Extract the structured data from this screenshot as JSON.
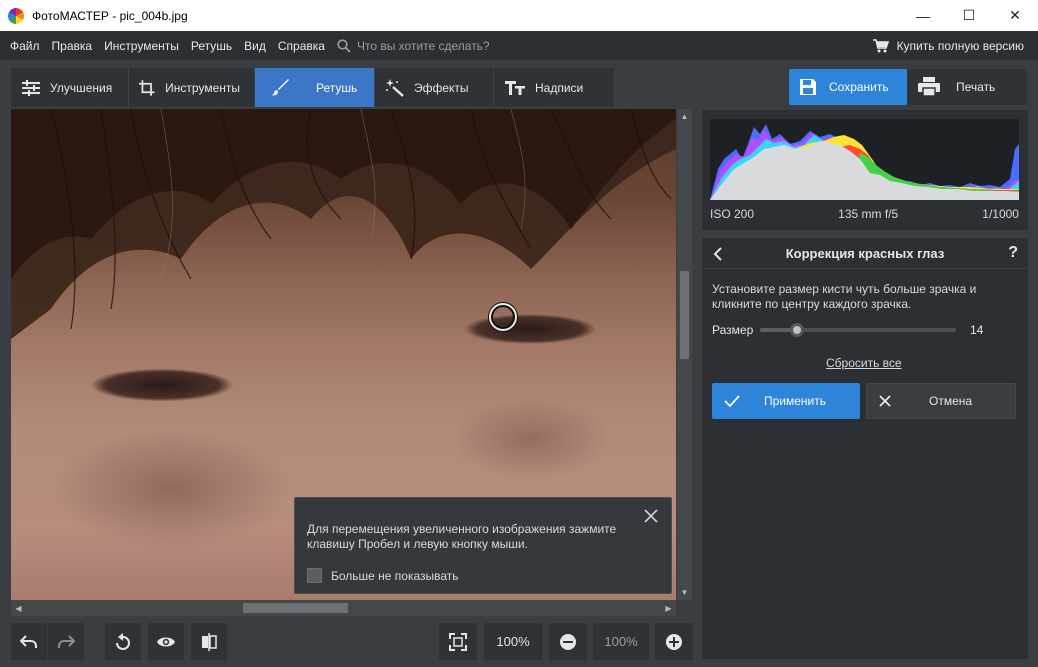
{
  "window": {
    "title": "ФотоМАСТЕР - pic_004b.jpg",
    "minimize_glyph": "—",
    "maximize_glyph": "☐",
    "close_glyph": "✕"
  },
  "menu": {
    "items": [
      "Файл",
      "Правка",
      "Инструменты",
      "Ретушь",
      "Вид",
      "Справка"
    ],
    "search_placeholder": "Что вы хотите сделать?",
    "buy_label": "Купить полную версию"
  },
  "tabs": [
    {
      "label": "Улучшения",
      "icon": "sliders-icon",
      "active": false
    },
    {
      "label": "Инструменты",
      "icon": "crop-icon",
      "active": false
    },
    {
      "label": "Ретушь",
      "icon": "brush-icon",
      "active": true
    },
    {
      "label": "Эффекты",
      "icon": "magic-wand-icon",
      "active": false
    },
    {
      "label": "Надписи",
      "icon": "text-icon",
      "active": false
    }
  ],
  "actions": {
    "save_label": "Сохранить",
    "print_label": "Печать"
  },
  "histogram": {
    "iso": "ISO 200",
    "lens": "135 mm f/5",
    "shutter": "1/1000"
  },
  "panel": {
    "title": "Коррекция красных глаз",
    "help": "?",
    "description": "Установите размер кисти чуть больше зрачка и кликните по центру каждого зрачка.",
    "size_label": "Размер",
    "size_value": "14",
    "size_fraction": 0.14,
    "reset_label": "Сбросить все",
    "apply_label": "Применить",
    "cancel_label": "Отмена"
  },
  "hint": {
    "text": "Для перемещения увеличенного изображения зажмите клавишу Пробел и левую кнопку мыши.",
    "checkbox_label": "Больше не показывать",
    "checked": false
  },
  "bottom": {
    "zoom_value": "100%",
    "zoom_field": "100%"
  },
  "colors": {
    "accent": "#2d84d9",
    "active_tab": "#3b75c8",
    "panel_bg": "#2c2f33",
    "app_bg": "#3a3d42"
  }
}
